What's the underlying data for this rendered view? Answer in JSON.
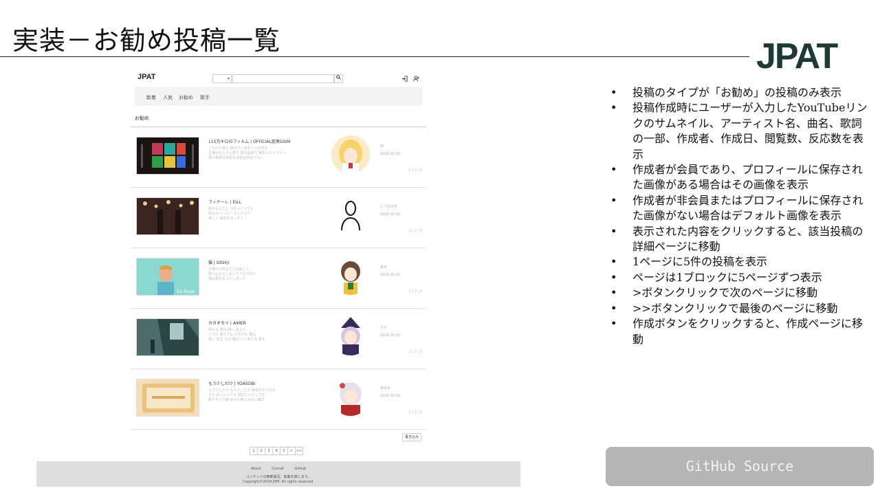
{
  "slide": {
    "title": "実装－お勧め投稿一覧",
    "logo": "JPAT"
  },
  "site": {
    "logo": "JPAT",
    "search": {
      "placeholder": ""
    },
    "nav": [
      "新着",
      "人気",
      "お勧め",
      "歌手"
    ],
    "section_title": "お勧め",
    "posts": [
      {
        "title": "115万キロのフィルム | OFFICIAL髭男DISM",
        "lyrics": [
          "これから僕ら 僕の行く道をいつの日か",
          "主演はもちろん君で 僕は監督で 脚本もカメラマン",
          "君の笑顔の表情も全部全部逃さない"
        ],
        "author": "ゆ",
        "date": "2024-10-31",
        "count": "0 | 1 | 6"
      },
      {
        "title": "フィナーレ | EILL",
        "lyrics": [
          "終わるんだと 分かっていても",
          "例えば ハッピーエンドより",
          "美しく 最後をまっすぐ"
        ],
        "author": "こうのゆき",
        "date": "2024-10-31",
        "count": "2 | 1 | 6"
      },
      {
        "title": "猫 | DISH//",
        "lyrics": [
          "夕焼けが燃えてこの街ごと",
          "飲み込んでしまいそうな今日に",
          "僕は君を失ってしまった"
        ],
        "author": "まゆ",
        "date": "2024-10-31",
        "count": "2 | 1 | 3"
      },
      {
        "title": "カタオモイ | AIMER",
        "lyrics": [
          "例えば 君の 顔に 昔より",
          "シワが 増えても それでも 僕は",
          "君に 恋を する 僕は いつまでも 君を"
        ],
        "author": "りか",
        "date": "2024-10-31",
        "count": "2 | 1 | 2"
      },
      {
        "title": "もう少しだけ | YOASOBI",
        "lyrics": [
          "もう少しだけ もう少しだけ 頑張れそうかな",
          "すぐ 近くにいても 特別じゃなくても",
          "眠りそうな朝 変わり映えのない毎日"
        ],
        "author": "あゆみ",
        "date": "2024-10-31",
        "count": "1 | 1 | 8"
      }
    ],
    "write_button": "書き込み",
    "pager": [
      "1",
      "2",
      "3",
      "4",
      "5",
      ">",
      ">>"
    ],
    "footer": {
      "links": [
        "About",
        "Concat",
        "Github"
      ],
      "line1": "コンテンツの無断複写、転載を禁じます。",
      "line2": "Copyright©2024 JPAT. All rights reserved."
    }
  },
  "bullets": [
    "投稿のタイプが「お勧め」の投稿のみ表示",
    "投稿作成時にユーザーが入力したYouTubeリンクのサムネイル、アーティスト名、曲名、歌詞の一部、作成者、作成日、閲覧数、反応数を表示",
    "作成者が会員であり、プロフィールに保存された画像がある場合はその画像を表示",
    "作成者が非会員またはプロフィールに保存された画像がない場合はデフォルト画像を表示",
    "表示された内容をクリックすると、該当投稿の詳細ページに移動",
    "1ページに5件の投稿を表示",
    "ページは1ブロックに5ページずつ表示",
    ">ボタンクリックで次のページに移動",
    ">>ボタンクリックで最後のページに移動",
    "作成ボタンをクリックすると、作成ページに移動"
  ],
  "github_button": "GitHub Source",
  "colors": {
    "logo": "#1f3a34",
    "github_button_bg": "#b5b5b5",
    "footer_bg": "#dedede"
  }
}
